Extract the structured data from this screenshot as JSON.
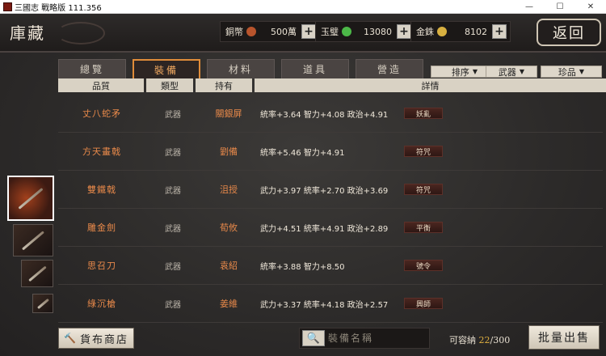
{
  "window": {
    "title": "三國志 戰略版 111.356",
    "minimize": "—",
    "maximize": "☐",
    "close": "✕"
  },
  "header": {
    "title": "庫藏",
    "back_label": "返回",
    "currencies": [
      {
        "label": "銅幣",
        "value": "500萬",
        "coin_color": "#b8542c",
        "plus": "+"
      },
      {
        "label": "玉璧",
        "value": "13080",
        "coin_color": "#4cb848",
        "plus": "+"
      },
      {
        "label": "金銖",
        "value": "8102",
        "coin_color": "#d8b040",
        "plus": "+"
      }
    ]
  },
  "tabs": [
    {
      "label": "總覽"
    },
    {
      "label": "裝備"
    },
    {
      "label": "材料"
    },
    {
      "label": "道具"
    },
    {
      "label": "營造"
    }
  ],
  "active_tab": "裝備",
  "filters": [
    {
      "label": "排序"
    },
    {
      "label": "武器"
    },
    {
      "label": "珍品"
    }
  ],
  "columns": [
    "品質",
    "類型",
    "持有",
    "詳情"
  ],
  "items": [
    {
      "name": "丈八蛇矛",
      "type": "武器",
      "owner": "關銀屏",
      "stats": "統率+3.64  智力+4.08  政治+4.91",
      "skill": "妖亂"
    },
    {
      "name": "方天畫戟",
      "type": "武器",
      "owner": "劉備",
      "stats": "統率+5.46  智力+4.91",
      "skill": "符咒"
    },
    {
      "name": "雙鐵戟",
      "type": "武器",
      "owner": "沮授",
      "stats": "武力+3.97  統率+2.70  政治+3.69",
      "skill": "符咒"
    },
    {
      "name": "雕金劍",
      "type": "武器",
      "owner": "荀攸",
      "stats": "武力+4.51  統率+4.91  政治+2.89",
      "skill": "平衡"
    },
    {
      "name": "思召刀",
      "type": "武器",
      "owner": "袁紹",
      "stats": "統率+3.88  智力+8.50",
      "skill": "號令"
    },
    {
      "name": "綠沉槍",
      "type": "武器",
      "owner": "姜維",
      "stats": "武力+3.37  統率+4.18  政治+2.57",
      "skill": "興師"
    }
  ],
  "footer": {
    "shop_label": "貨布商店",
    "shop_icon": "🔨",
    "search_placeholder": "裝備名稱",
    "search_icon": "🔍",
    "capacity_label": "可容納",
    "capacity_current": "22",
    "capacity_max": "/300",
    "sell_label": "批量出售"
  }
}
